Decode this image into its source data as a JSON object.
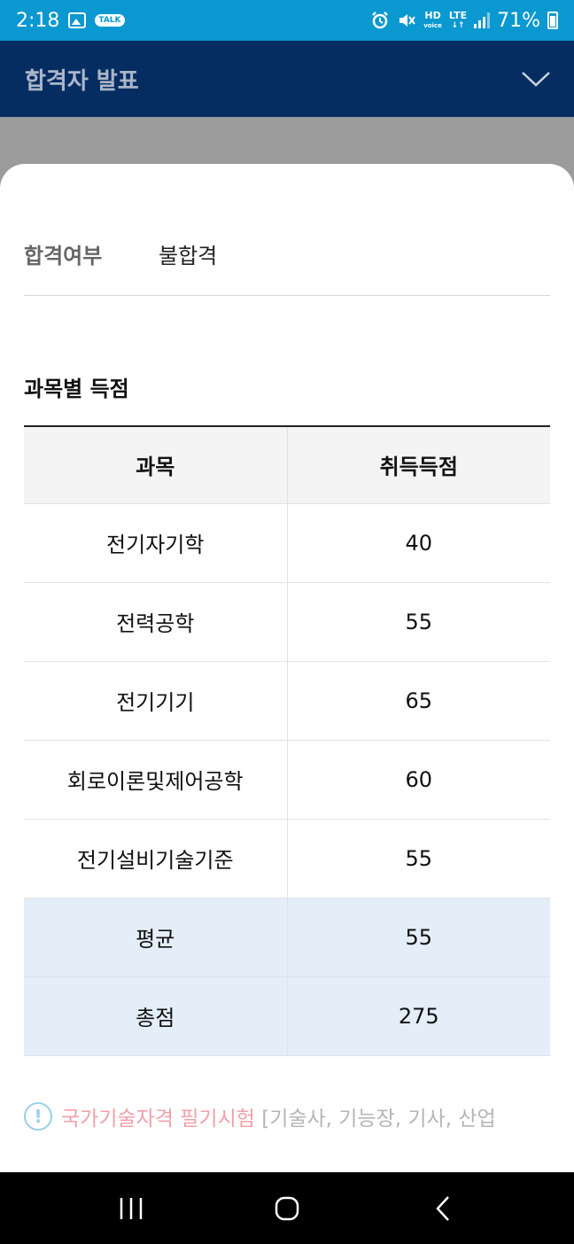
{
  "status_bar": {
    "time": "2:18",
    "talk_badge": "TALK",
    "hd_label": "HD",
    "voice_label": "voice",
    "lte_label": "LTE",
    "battery": "71%"
  },
  "header": {
    "title": "합격자 발표"
  },
  "result": {
    "label": "합격여부",
    "value": "불합격"
  },
  "scores": {
    "section_title": "과목별 득점",
    "columns": [
      "과목",
      "취득득점"
    ],
    "rows": [
      {
        "subject": "전기자기학",
        "score": "40"
      },
      {
        "subject": "전력공학",
        "score": "55"
      },
      {
        "subject": "전기기기",
        "score": "65"
      },
      {
        "subject": "회로이론및제어공학",
        "score": "60"
      },
      {
        "subject": "전기설비기술기준",
        "score": "55"
      }
    ],
    "average": {
      "label": "평균",
      "value": "55"
    },
    "total": {
      "label": "총점",
      "value": "275"
    }
  },
  "notice": {
    "highlight": "국가기술자격 필기시험",
    "rest": " [기술사, 기능장, 기사, 산업"
  },
  "colors": {
    "status_bar": "#0a98d0",
    "header": "#062d62",
    "summary_row": "#e4eef9",
    "notice_highlight": "#f2a0a8"
  }
}
